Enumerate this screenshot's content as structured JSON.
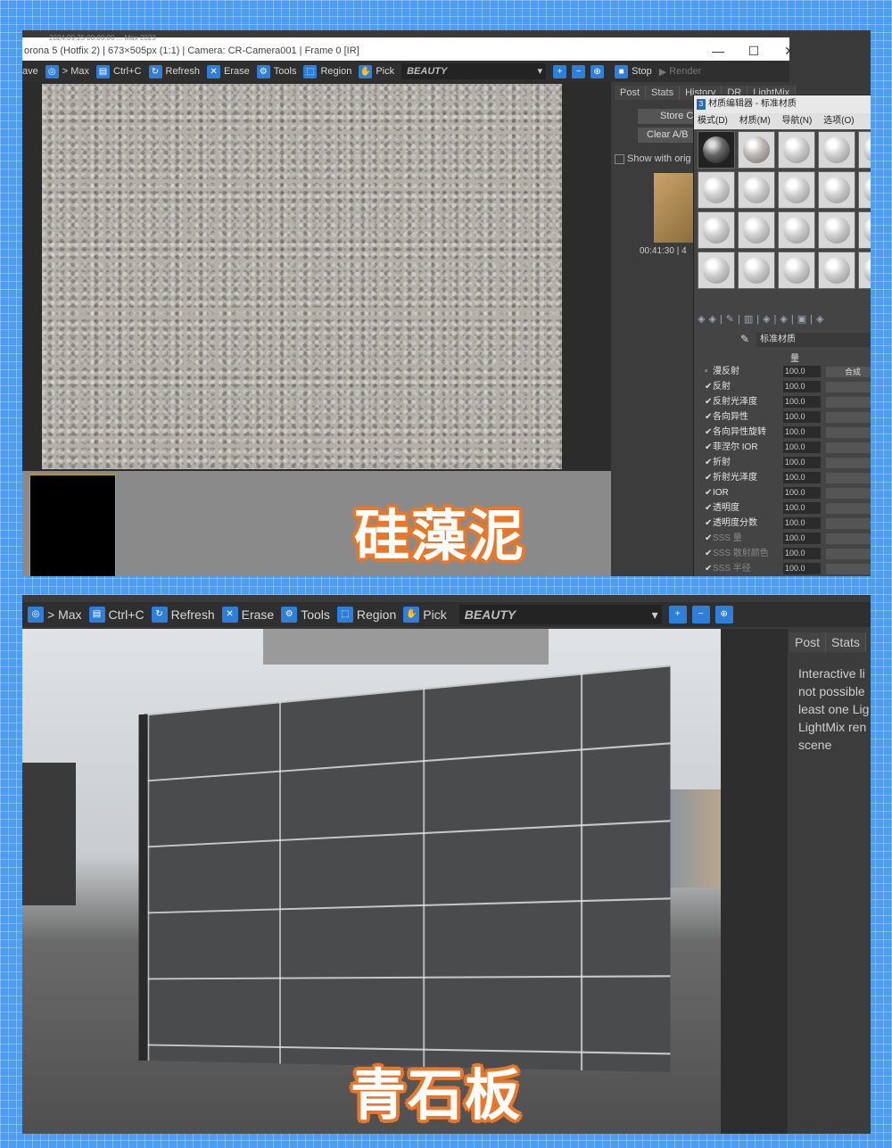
{
  "top": {
    "title_small": "2024.09.25 00:00:00 ... Max 2023",
    "title": "orona 5 (Hotfix 2) | 673×505px (1:1) | Camera: CR-Camera001 | Frame 0 [IR]",
    "toolbar": {
      "save": "ave",
      "to_max": "> Max",
      "copy": "Ctrl+C",
      "refresh": "Refresh",
      "erase": "Erase",
      "tools": "Tools",
      "region": "Region",
      "pick": "Pick",
      "beauty": "BEAUTY",
      "stop": "Stop",
      "render": "Render"
    },
    "side_tabs": [
      "Post",
      "Stats",
      "History",
      "DR",
      "LightMix"
    ],
    "store_button": "Store C",
    "clear_button": "Clear A/B",
    "show_original": "Show with orig",
    "history_time": "00:41:30 | 4",
    "material_editor": {
      "title": "材质编辑器 - 标准材质",
      "menu": [
        "模式(D)",
        "材质(M)",
        "导航(N)",
        "选项(O)"
      ],
      "material_name": "标准材质",
      "col_header": "量",
      "params": [
        {
          "label": "漫反射",
          "value": "100.0",
          "map": "合成",
          "checked": false
        },
        {
          "label": "反射",
          "value": "100.0",
          "map": "",
          "checked": true
        },
        {
          "label": "反射光泽度",
          "value": "100.0",
          "map": "",
          "checked": true
        },
        {
          "label": "各向异性",
          "value": "100.0",
          "map": "",
          "checked": true
        },
        {
          "label": "各向异性旋转",
          "value": "100.0",
          "map": "",
          "checked": true
        },
        {
          "label": "菲涅尔 IOR",
          "value": "100.0",
          "map": "",
          "checked": true
        },
        {
          "label": "折射",
          "value": "100.0",
          "map": "",
          "checked": true
        },
        {
          "label": "折射光泽度",
          "value": "100.0",
          "map": "",
          "checked": true
        },
        {
          "label": "IOR",
          "value": "100.0",
          "map": "",
          "checked": true
        },
        {
          "label": "透明度",
          "value": "100.0",
          "map": "",
          "checked": true
        },
        {
          "label": "透明度分数",
          "value": "100.0",
          "map": "",
          "checked": true
        },
        {
          "label": "SSS 量",
          "value": "100.0",
          "map": "",
          "checked": true
        },
        {
          "label": "SSS 散射颜色",
          "value": "100.0",
          "map": "",
          "checked": true
        },
        {
          "label": "SSS 半径",
          "value": "100.0",
          "map": "",
          "checked": true
        }
      ]
    },
    "caption": "硅藻泥"
  },
  "bottom": {
    "toolbar": {
      "to_max": "> Max",
      "copy": "Ctrl+C",
      "refresh": "Refresh",
      "erase": "Erase",
      "tools": "Tools",
      "region": "Region",
      "pick": "Pick",
      "beauty": "BEAUTY"
    },
    "side_tabs": [
      "Post",
      "Stats"
    ],
    "info_lines": [
      "Interactive li",
      "not possible",
      "least one Lig",
      "LightMix ren",
      "scene"
    ],
    "caption": "青石板"
  },
  "colors": {
    "background": "#4d9df0",
    "caption_outline": "#e8772a",
    "toolbar_icon": "#2f7fd8"
  }
}
